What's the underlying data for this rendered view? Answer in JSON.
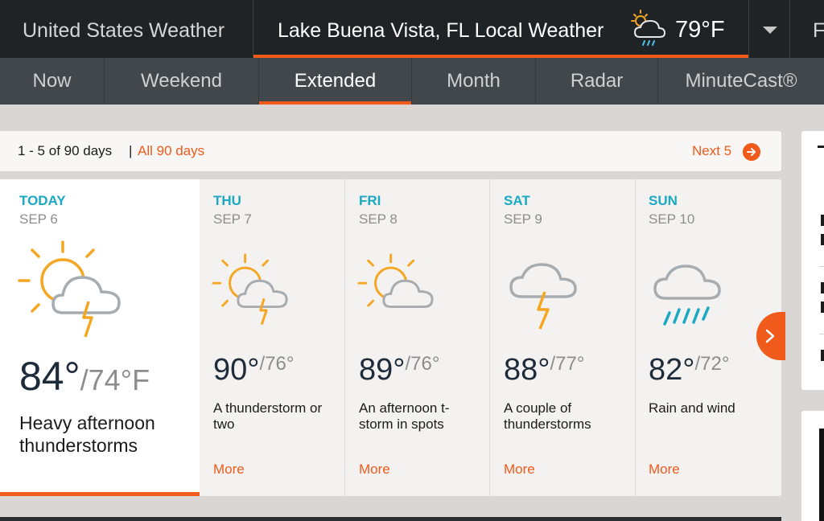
{
  "header": {
    "country_title": "United States Weather",
    "location_title": "Lake Buena Vista, FL Local Weather",
    "current_temp": "79°F",
    "current_icon": "sun-cloud-rain-icon",
    "clipped_tab": "F"
  },
  "subnav": {
    "tabs": [
      {
        "label": "Now",
        "active": false
      },
      {
        "label": "Weekend",
        "active": false
      },
      {
        "label": "Extended",
        "active": true
      },
      {
        "label": "Month",
        "active": false
      },
      {
        "label": "Radar",
        "active": false
      },
      {
        "label": "MinuteCast®",
        "active": false
      }
    ]
  },
  "range": {
    "text": "1 - 5 of 90 days",
    "separator": "|",
    "all_link": "All 90 days",
    "next_label": "Next 5"
  },
  "forecast": [
    {
      "day": "TODAY",
      "date": "SEP 6",
      "hi": "84°",
      "lo": "/74°F",
      "desc": "Heavy afternoon thunderstorms",
      "icon": "sun-cloud-lightning-icon"
    },
    {
      "day": "THU",
      "date": "SEP 7",
      "hi": "90°",
      "lo": "/76°",
      "desc": "A thunderstorm or two",
      "more": "More",
      "icon": "sun-cloud-lightning-icon"
    },
    {
      "day": "FRI",
      "date": "SEP 8",
      "hi": "89°",
      "lo": "/76°",
      "desc": "An afternoon t-storm in spots",
      "more": "More",
      "icon": "sun-cloud-icon"
    },
    {
      "day": "SAT",
      "date": "SEP 9",
      "hi": "88°",
      "lo": "/77°",
      "desc": "A couple of thunderstorms",
      "more": "More",
      "icon": "cloud-lightning-icon"
    },
    {
      "day": "SUN",
      "date": "SEP 10",
      "hi": "82°",
      "lo": "/72°",
      "desc": "Rain and wind",
      "more": "More",
      "icon": "cloud-rain-icon"
    }
  ],
  "colors": {
    "accent": "#f05a1a",
    "day_label": "#1aa8c2",
    "header_bg": "#1f2326",
    "subnav_bg": "#42474b"
  }
}
